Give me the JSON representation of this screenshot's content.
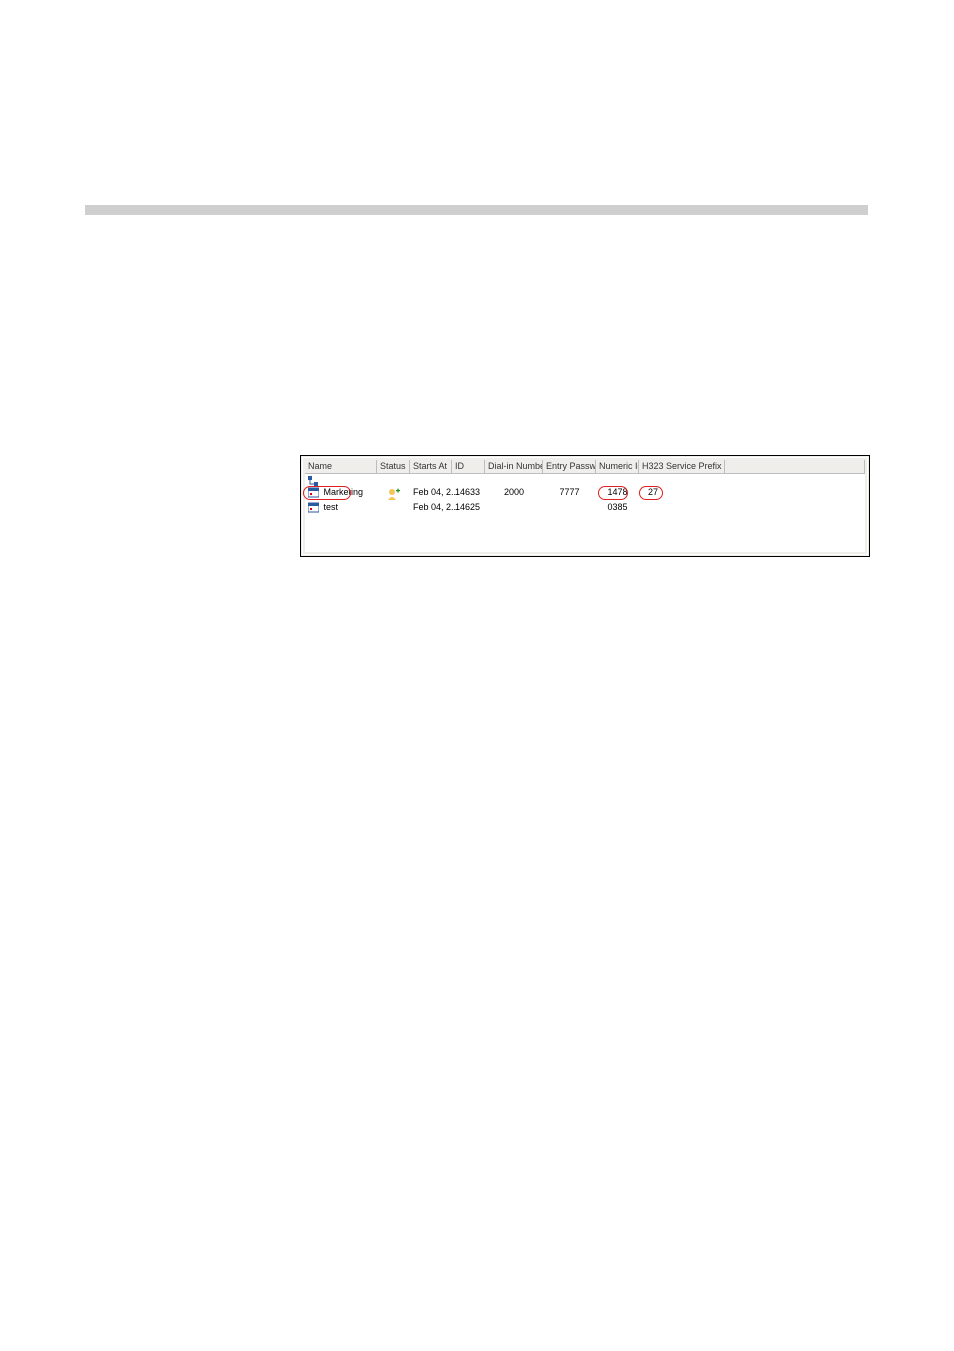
{
  "columns": {
    "name": "Name",
    "status": "Status",
    "starts_at": "Starts At",
    "id": "ID",
    "dialin": "Dial-in Number",
    "entry_pw": "Entry Password",
    "numeric_id": "Numeric Id",
    "prefix": "H323 Service Prefix"
  },
  "rows": [
    {
      "name": "Marketing",
      "starts_at": "Feb 04, 2...",
      "id": "14633",
      "dialin": "2000",
      "entry_pw": "7777",
      "numeric_id": "1478",
      "prefix": "27",
      "has_status_icon": true,
      "circled": true
    },
    {
      "name": "test",
      "starts_at": "Feb 04, 2...",
      "id": "14625",
      "dialin": "",
      "entry_pw": "",
      "numeric_id": "0385",
      "prefix": "",
      "has_status_icon": false,
      "circled": false
    }
  ]
}
